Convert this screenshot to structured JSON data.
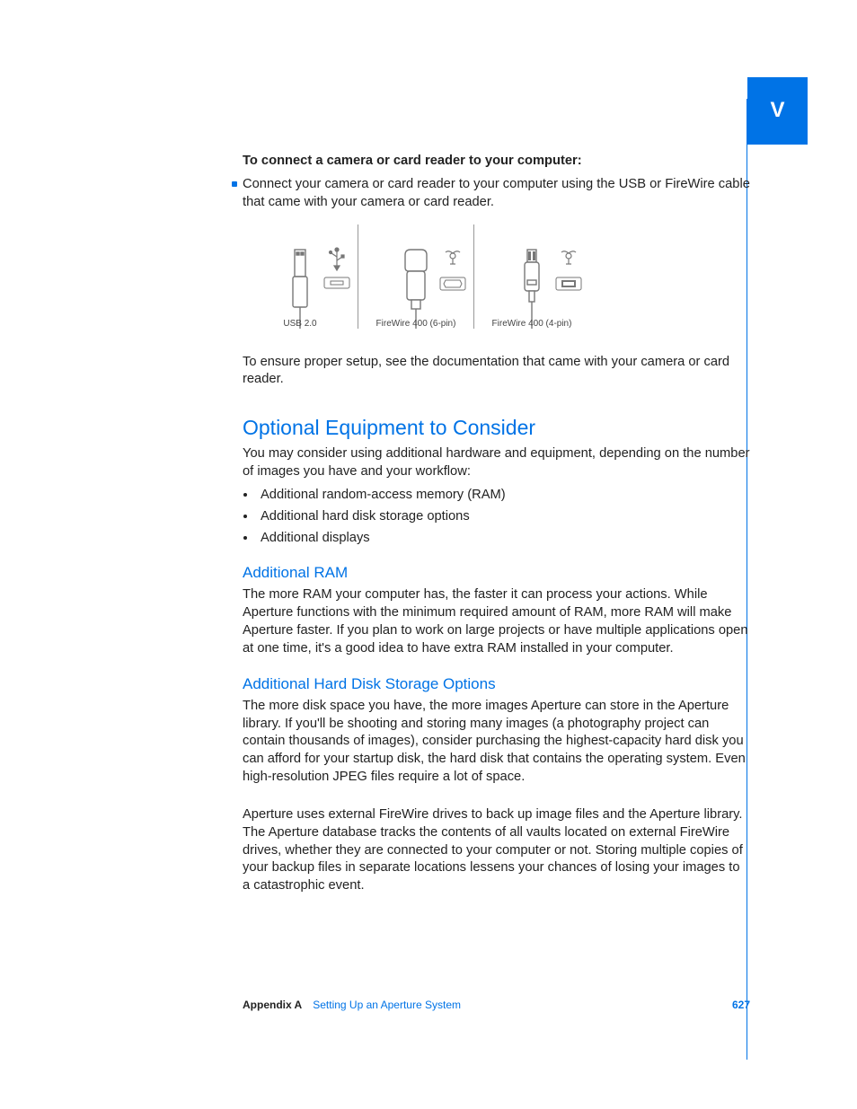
{
  "tab_letter": "V",
  "intro_bold": "To connect a camera or card reader to your computer:",
  "intro_bullet": "Connect your camera or card reader to your computer using the USB or FireWire cable that came with your camera or card reader.",
  "connectors": [
    {
      "label": "USB 2.0"
    },
    {
      "label": "FireWire 400 (6-pin)"
    },
    {
      "label": "FireWire 400 (4-pin)"
    }
  ],
  "after_connectors": "To ensure proper setup, see the documentation that came with your camera or card reader.",
  "section_heading": "Optional Equipment to Consider",
  "section_intro": "You may consider using additional hardware and equipment, depending on the number of images you have and your workflow:",
  "equipment_list": [
    "Additional random-access memory (RAM)",
    "Additional hard disk storage options",
    "Additional displays"
  ],
  "ram_heading": "Additional RAM",
  "ram_body": "The more RAM your computer has, the faster it can process your actions. While Aperture functions with the minimum required amount of RAM, more RAM will make Aperture faster. If you plan to work on large projects or have multiple applications open at one time, it's a good idea to have extra RAM installed in your computer.",
  "hdd_heading": "Additional Hard Disk Storage Options",
  "hdd_body1": "The more disk space you have, the more images Aperture can store in the Aperture library. If you'll be shooting and storing many images (a photography project can contain thousands of images), consider purchasing the highest-capacity hard disk you can afford for your startup disk, the hard disk that contains the operating system. Even high-resolution JPEG files require a lot of space.",
  "hdd_body2": "Aperture uses external FireWire drives to back up image files and the Aperture library. The Aperture database tracks the contents of all vaults located on external FireWire drives, whether they are connected to your computer or not. Storing multiple copies of your backup files in separate locations lessens your chances of losing your images to a catastrophic event.",
  "footer": {
    "appendix": "Appendix A",
    "title": "Setting Up an Aperture System",
    "page": "627"
  }
}
